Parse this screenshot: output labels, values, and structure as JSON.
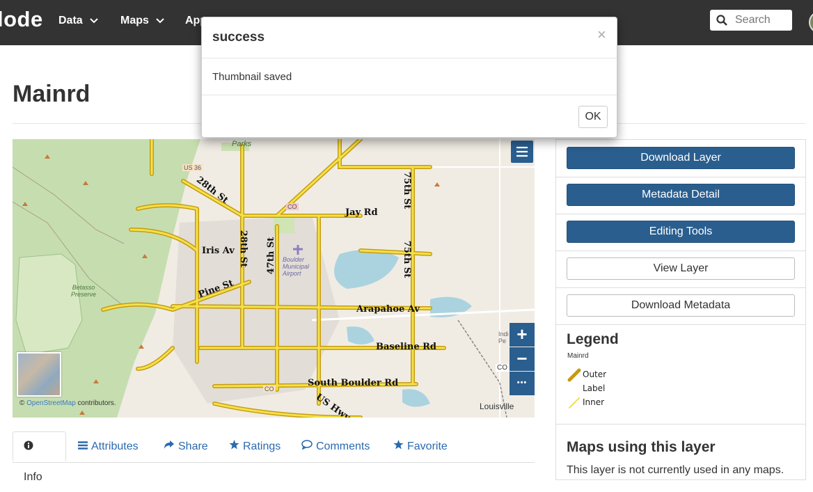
{
  "navbar": {
    "brand": "lode",
    "items": [
      {
        "label": "Data"
      },
      {
        "label": "Maps"
      },
      {
        "label": "App"
      }
    ],
    "search_placeholder": "Search"
  },
  "page": {
    "title": "Mainrd"
  },
  "map": {
    "labels": [
      "28th St",
      "Jay Rd",
      "75th St",
      "28th St",
      "Iris Av",
      "47th St",
      "75th St",
      "Pine St",
      "Arapahoe Av",
      "Baseline Rd",
      "South Boulder Rd",
      "US Hwy",
      "Parks",
      "Betasso Preserve",
      "Boulder Municipal Airport",
      "Louisville",
      "US 36",
      "CO",
      "CO",
      "CO",
      "Indi Pe"
    ],
    "zoom_in": "+",
    "zoom_out": "−",
    "more": "•••",
    "attribution_prefix": "© ",
    "attribution_link": "OpenStreetMap",
    "attribution_suffix": " contributors."
  },
  "tabs": [
    {
      "label": "Info",
      "icon": "info-circle-icon",
      "active": true
    },
    {
      "label": "Attributes",
      "icon": "list-icon"
    },
    {
      "label": "Share",
      "icon": "share-icon"
    },
    {
      "label": "Ratings",
      "icon": "star-icon"
    },
    {
      "label": "Comments",
      "icon": "comment-icon"
    },
    {
      "label": "Favorite",
      "icon": "star-icon"
    }
  ],
  "panel": {
    "buttons": {
      "download_layer": "Download Layer",
      "metadata_detail": "Metadata Detail",
      "editing_tools": "Editing Tools",
      "view_layer": "View Layer",
      "download_metadata": "Download Metadata"
    },
    "legend": {
      "title": "Legend",
      "layer": "Mainrd",
      "items": [
        {
          "label": "Outer",
          "color": "#c89a10"
        },
        {
          "label": "Label"
        },
        {
          "label": "Inner",
          "color": "#f2e24a"
        }
      ]
    },
    "maps_using": {
      "title": "Maps using this layer",
      "text": "This layer is not currently used in any maps."
    }
  },
  "modal": {
    "title": "success",
    "close": "×",
    "body": "Thumbnail saved",
    "ok": "OK"
  },
  "colors": {
    "navbar": "#333333",
    "primary": "#2a5e8e",
    "road": "#e6c020",
    "link": "#2a6ab0"
  }
}
